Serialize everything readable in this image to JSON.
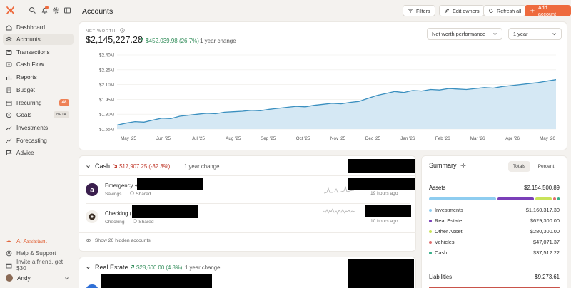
{
  "colors": {
    "accent": "#ee6a3d",
    "positive": "#2e8b57",
    "negative": "#c0392b",
    "investments": "#8ecdf0",
    "real_estate": "#7a3fb8",
    "other_asset": "#c9e35a",
    "vehicles": "#e06e6e",
    "cash": "#38b08a",
    "chart_line": "#3a8fbf",
    "chart_fill": "#d5e8f4"
  },
  "sidebar": {
    "tools": [
      {
        "icon": "search-icon"
      },
      {
        "icon": "bell-icon"
      },
      {
        "icon": "gear-icon"
      },
      {
        "icon": "panel-toggle-icon"
      }
    ],
    "items": [
      {
        "label": "Dashboard",
        "icon": "dashboard-icon"
      },
      {
        "label": "Accounts",
        "icon": "accounts-icon",
        "active": true
      },
      {
        "label": "Transactions",
        "icon": "transactions-icon"
      },
      {
        "label": "Cash Flow",
        "icon": "cash-flow-icon"
      },
      {
        "label": "Reports",
        "icon": "reports-icon"
      },
      {
        "label": "Budget",
        "icon": "budget-icon"
      },
      {
        "label": "Recurring",
        "icon": "recurring-icon",
        "badge": "48"
      },
      {
        "label": "Goals",
        "icon": "goals-icon",
        "tag": "BETA"
      },
      {
        "label": "Investments",
        "icon": "investments-icon"
      },
      {
        "label": "Forecasting",
        "icon": "forecasting-icon"
      },
      {
        "label": "Advice",
        "icon": "advice-icon"
      }
    ],
    "bottom": {
      "ai_assistant": "AI Assistant",
      "help": "Help & Support",
      "invite": "Invite a friend, get $30",
      "user": "Andy"
    }
  },
  "header": {
    "title": "Accounts",
    "filters": "Filters",
    "edit_owners": "Edit owners",
    "refresh_all": "Refresh all",
    "add_account": "Add account"
  },
  "net_worth": {
    "label": "NET WORTH",
    "value": "$2,145,227.28",
    "change": "$452,039.98 (26.7%)",
    "change_note": "1 year change",
    "chart_select": "Net worth performance",
    "period_select": "1 year"
  },
  "chart_data": {
    "type": "area",
    "title": "",
    "xlabel": "",
    "ylabel": "",
    "ylim": [
      1650000,
      2400000
    ],
    "y_ticks": [
      "$2.40M",
      "$2.25M",
      "$2.10M",
      "$1.95M",
      "$1.80M",
      "$1.65M"
    ],
    "y_tick_values": [
      2400000,
      2250000,
      2100000,
      1950000,
      1800000,
      1650000
    ],
    "x_ticks": [
      "May '25",
      "Jun '25",
      "Jul '25",
      "Aug '25",
      "Sep '25",
      "Oct '25",
      "Nov '25",
      "Dec '25",
      "Jan '26",
      "Feb '26",
      "Mar '26",
      "Apr '26",
      "May '26"
    ],
    "grid": true,
    "series": [
      {
        "values": [
          1690000,
          1710000,
          1725000,
          1720000,
          1740000,
          1760000,
          1755000,
          1780000,
          1790000,
          1800000,
          1810000,
          1805000,
          1820000,
          1825000,
          1830000,
          1840000,
          1835000,
          1850000,
          1860000,
          1870000,
          1880000,
          1875000,
          1890000,
          1900000,
          1910000,
          1905000,
          1920000,
          1930000,
          1960000,
          1990000,
          2010000,
          2030000,
          2020000,
          2040000,
          2035000,
          2050000,
          2045000,
          2060000,
          2055000,
          2050000,
          2060000,
          2070000,
          2065000,
          2080000,
          2090000,
          2100000,
          2110000,
          2120000,
          2135000,
          2150000
        ]
      }
    ]
  },
  "cash": {
    "title": "Cash",
    "change": "$17,907.25 (-32.3%)",
    "change_note": "1 year change",
    "accounts": [
      {
        "name": "Emergency +",
        "type": "Savings",
        "owner": "Shared",
        "updated": "19 hours ago"
      },
      {
        "name": "Checking (",
        "type": "Checking",
        "owner": "Shared",
        "updated": "10 hours ago"
      }
    ],
    "hidden": "Show 26 hidden accounts"
  },
  "real_estate": {
    "title": "Real Estate",
    "change": "$28,600.00 (4.8%)",
    "change_note": "1 year change"
  },
  "summary": {
    "title": "Summary",
    "tab_totals": "Totals",
    "tab_percent": "Percent",
    "assets_label": "Assets",
    "assets_total": "$2,154,500.89",
    "assets": [
      {
        "label": "Investments",
        "value": "$1,160,317.30",
        "amount": 1160317.3
      },
      {
        "label": "Real Estate",
        "value": "$629,300.00",
        "amount": 629300.0
      },
      {
        "label": "Other Asset",
        "value": "$280,300.00",
        "amount": 280300.0
      },
      {
        "label": "Vehicles",
        "value": "$47,071.37",
        "amount": 47071.37
      },
      {
        "label": "Cash",
        "value": "$37,512.22",
        "amount": 37512.22
      }
    ],
    "liabilities_label": "Liabilities",
    "liabilities_total": "$9,273.61"
  }
}
